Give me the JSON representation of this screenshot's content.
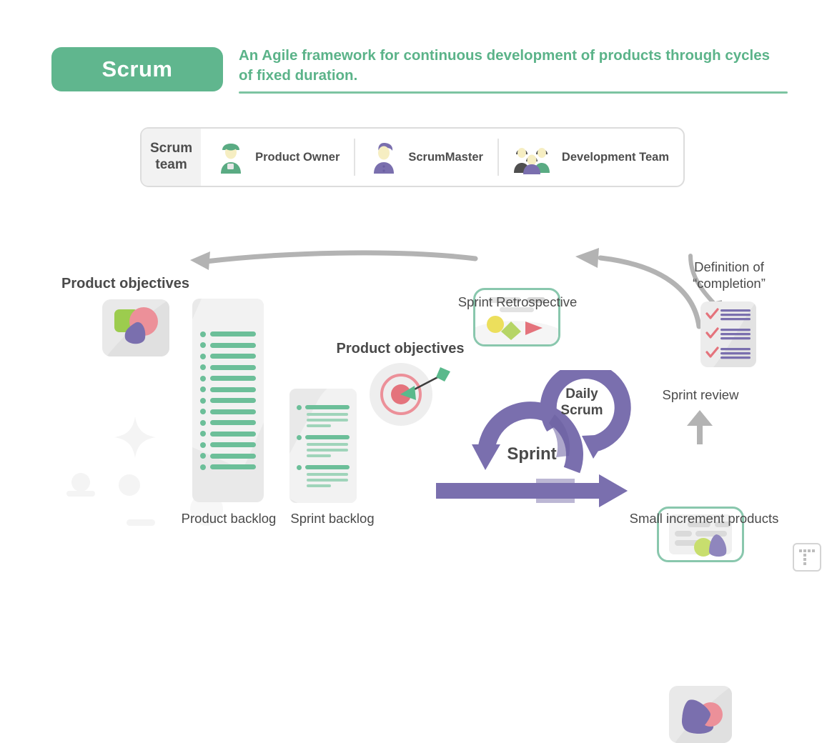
{
  "header": {
    "pill_label": "Scrum",
    "description": "An Agile framework for continuous development of products through cycles of fixed duration."
  },
  "scrum_team": {
    "title": "Scrum\nteam",
    "members": [
      {
        "label": "Product Owner",
        "icon": "person-green-icon"
      },
      {
        "label": "ScrumMaster",
        "icon": "person-purple-icon"
      },
      {
        "label": "Development Team",
        "icon": "people-group-icon"
      }
    ]
  },
  "nodes": {
    "product_objectives_left": "Product objectives",
    "product_backlog": "Product backlog",
    "sprint_backlog": "Sprint backlog",
    "product_objectives_center": "Product objectives",
    "sprint": "Sprint",
    "daily_scrum": "Daily\nScrum",
    "sprint_retrospective": "Sprint Retrospective",
    "sprint_review": "Sprint review",
    "definition_of_completion": "Definition of\n“completion”",
    "small_increment_products": "Small increment products"
  },
  "icons": {
    "product_objectives_tile": "shapes-image-icon",
    "target": "target-dartboard-icon",
    "retrospective_card": "board-with-shapes-icon",
    "review_card": "review-document-icon",
    "definition_doc": "checklist-document-icon",
    "increment_tile": "shapes-image-icon",
    "arrow_backlog_to_objectives": "curved-left-arrow-icon",
    "arrow_review_to_retrospective": "curved-left-arrow-icon",
    "arrow_completion_to_review": "curved-down-arrow-icon",
    "arrow_increment_to_review": "up-arrow-icon",
    "sprint_cycle": "circular-arrow-icon",
    "daily_scrum_cycle": "circular-arrow-icon",
    "sprint_output": "right-arrow-icon",
    "corner_logo": "dot-grid-logo-icon"
  },
  "colors": {
    "green": "#60b68e",
    "green_light": "#6cbf99",
    "green_outline": "#89c7ad",
    "purple": "#7a6fae",
    "purple_light": "#8f86bd",
    "pink": "#ec9099",
    "red": "#e4737c",
    "lime": "#a9d25c",
    "yellow": "#ecdf5c",
    "grey": "#b3b3b3",
    "grey_light": "#e9e9e9",
    "text": "#4a4a4a"
  },
  "chart_data": {
    "type": "diagram",
    "title": "Scrum framework flow",
    "flow": [
      {
        "from": "Product objectives",
        "to": "Product backlog"
      },
      {
        "from": "Product backlog",
        "to": "Sprint backlog"
      },
      {
        "from": "Sprint backlog",
        "to": "Sprint"
      },
      {
        "from": "Sprint",
        "to": "Daily Scrum"
      },
      {
        "from": "Sprint",
        "to": "Small increment products"
      },
      {
        "from": "Small increment products",
        "to": "Sprint review"
      },
      {
        "from": "Definition of “completion”",
        "to": "Sprint review"
      },
      {
        "from": "Sprint review",
        "to": "Sprint Retrospective"
      },
      {
        "from": "Sprint Retrospective",
        "to": "Product objectives"
      }
    ],
    "backlog_item_counts": {
      "product_backlog": 13,
      "sprint_backlog_groups": 3,
      "sprint_backlog_sublines_per_group": 3
    }
  }
}
